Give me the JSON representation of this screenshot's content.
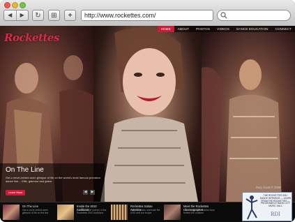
{
  "browser": {
    "url": "http://www.rockettes.com/",
    "buttons": {
      "back": "◀",
      "forward": "▶",
      "reload": "↻",
      "bookmarks": "⊞",
      "add": "+"
    }
  },
  "site": {
    "logo": "Rockettes",
    "nav": [
      "HOME",
      "ABOUT",
      "PHOTOS",
      "VIDEOS",
      "DANCE EDUCATION",
      "CONNECT"
    ],
    "nav_active": "HOME",
    "accent_color": "#c81d3a"
  },
  "hero": {
    "title": "On The Line",
    "description": "Get a never-before-seen glimpse of life on the world's most famous precision dance line... Glitz, glamour and grace.",
    "cta": "Learn More",
    "prev": "◀",
    "next": "▶",
    "photo_credit": "Rory Gavis © 2008"
  },
  "features": [
    {
      "title": "On The Line",
      "desc": "Get a never-before-seen glimpse of life on the line"
    },
    {
      "title": "Inside the 2010 Auditions",
      "desc": "Go behind the scenes of the Rockettes 2010 auditions"
    },
    {
      "title": "Rockettes Salute America",
      "desc": "The Rockettes celebrate the USO and our troops"
    },
    {
      "title": "Meet the Rockettes Choreographer",
      "desc": "Learn about the creative force behind the routines"
    }
  ],
  "ad": {
    "text": "THE ROCKETTES 2011 DANCE INTENSIVE — LEARN FROM THE ROCKETTES — PROGRAMS AT RADIO CITY MUSIC HALL",
    "logo": "RDI"
  }
}
